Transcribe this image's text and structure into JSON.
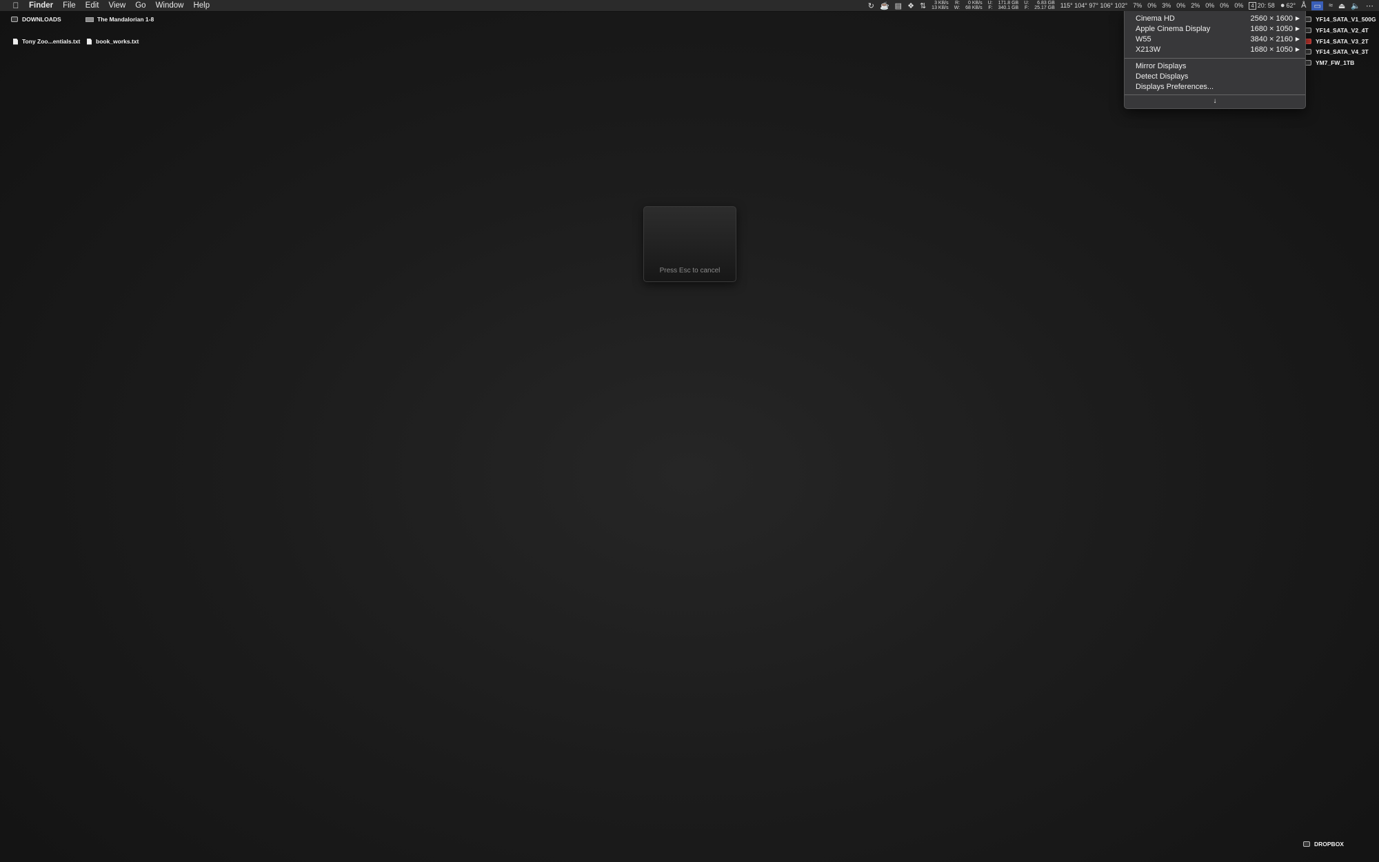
{
  "menubar": {
    "app": "Finder",
    "items": [
      "File",
      "Edit",
      "View",
      "Go",
      "Window",
      "Help"
    ]
  },
  "status": {
    "net1_top": "3 KB/s",
    "net1_bottom": "13 KB/s",
    "rw_top": "R:",
    "rw_bottom": "W:",
    "net2_top": "0 KB/s",
    "net2_bottom": "68 KB/s",
    "uf1_top": "U:",
    "uf1_bottom": "F:",
    "disk1_top": "171.8 GB",
    "disk1_bottom": "340.1 GB",
    "uf2_top": "U:",
    "uf2_bottom": "F:",
    "disk2_top": "6.83 GB",
    "disk2_bottom": "25.17 GB",
    "temps": "115° 104° 97° 106° 102°",
    "cpu": [
      "7%",
      "0%",
      "3%",
      "0%",
      "2%",
      "0%",
      "0%",
      "0%"
    ],
    "badge": "4",
    "time": "20: 58",
    "temp": "62°"
  },
  "desktop": {
    "top_items": [
      "DOWNLOADS",
      "The Mandalorian 1-8"
    ],
    "files": [
      "Tony Zoo...entials.txt",
      "book_works.txt"
    ],
    "drives": [
      "YF14_SATA_V1_500G",
      "YF14_SATA_V2_4T",
      "YF14_SATA_V3_2T",
      "YF14_SATA_V4_3T",
      "YM7_FW_1TB"
    ],
    "bottom_item": "DROPBOX"
  },
  "display_menu": {
    "displays": [
      {
        "name": "Cinema HD",
        "resolution": "2560 × 1600"
      },
      {
        "name": "Apple Cinema Display",
        "resolution": "1680 × 1050"
      },
      {
        "name": "W55",
        "resolution": "3840 × 2160"
      },
      {
        "name": "X213W",
        "resolution": "1680 × 1050"
      }
    ],
    "actions": [
      "Mirror Displays",
      "Detect Displays",
      "Displays Preferences..."
    ],
    "more_glyph": "↓"
  },
  "overlay": {
    "hint": "Press Esc to cancel"
  },
  "colors": {
    "menubar": "#2b2b2b",
    "dropdown": "#3a3a3c",
    "drive_red": "#c2362e"
  }
}
